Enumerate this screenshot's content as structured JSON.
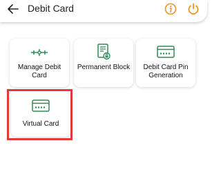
{
  "header": {
    "title": "Debit Card",
    "back_icon": "arrow-left-icon",
    "info_icon": "info-icon",
    "power_icon": "power-icon"
  },
  "colors": {
    "accent_green": "#2e8b57",
    "accent_orange": "#f29122",
    "highlight_red": "#e53935"
  },
  "tiles": [
    {
      "label": "Manage Debit Card",
      "icon": "sliders-icon"
    },
    {
      "label": "Permanent Block",
      "icon": "document-lock-icon"
    },
    {
      "label": "Debit Card Pin Generation",
      "icon": "card-pin-icon"
    },
    {
      "label": "Virtual Card",
      "icon": "card-icon"
    }
  ]
}
